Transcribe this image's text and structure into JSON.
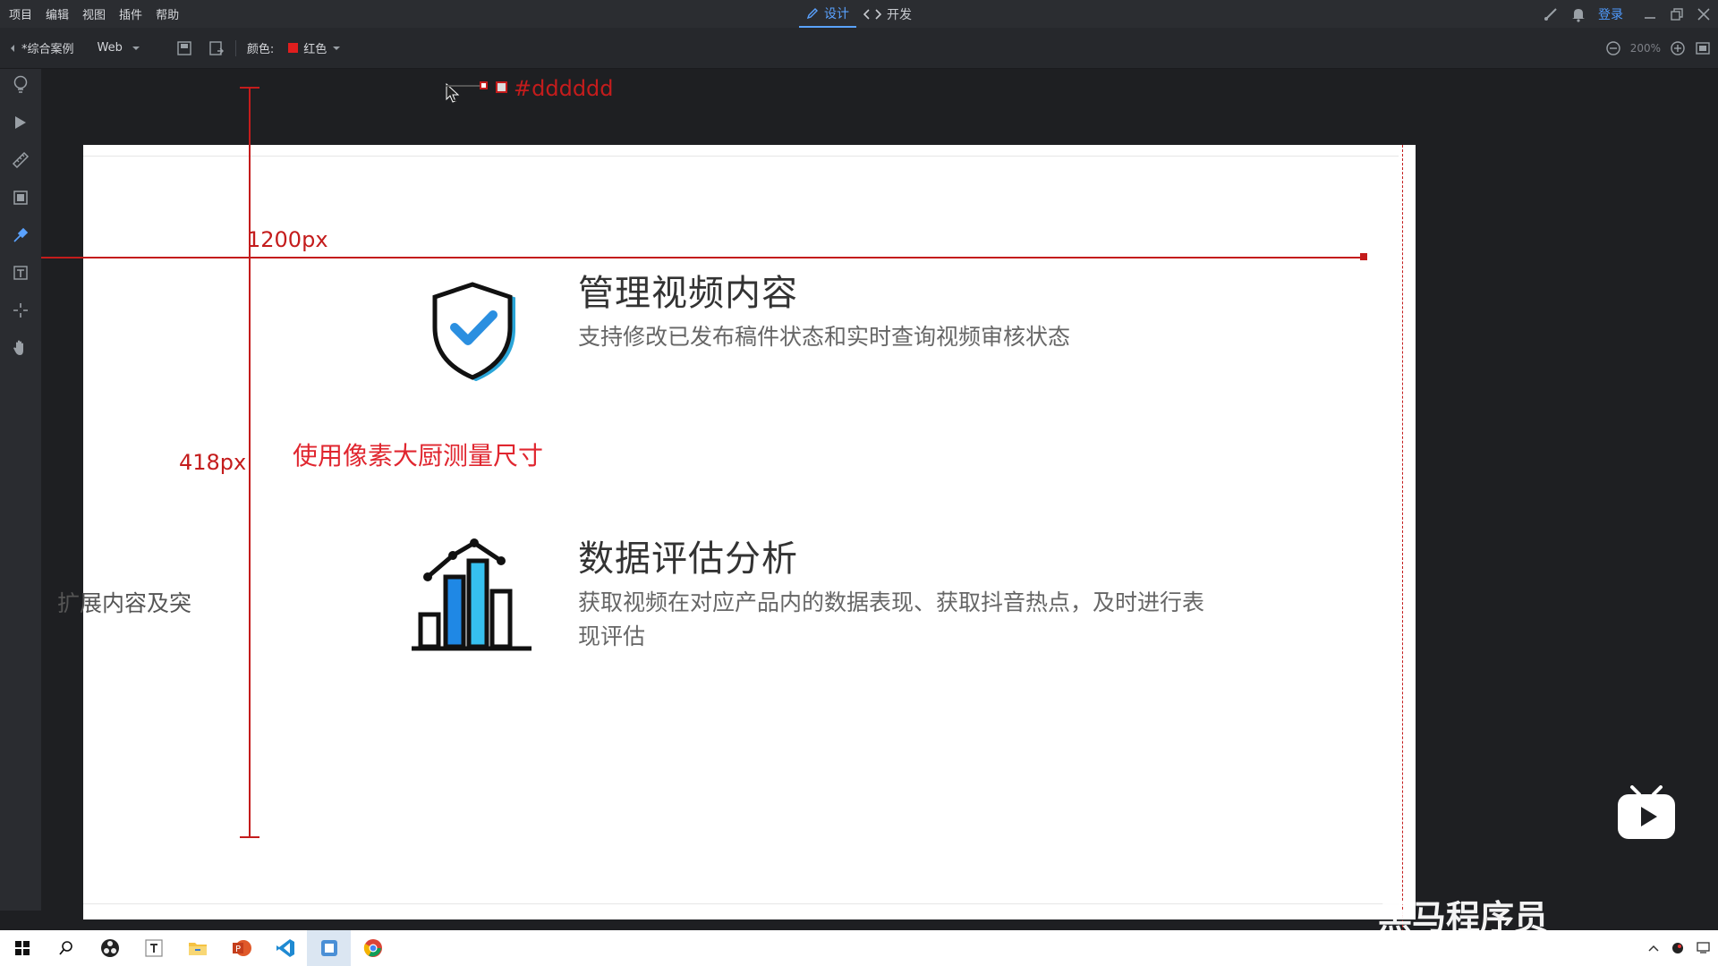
{
  "menubar": {
    "items": [
      "项目",
      "编辑",
      "视图",
      "插件",
      "帮助"
    ],
    "mode_tabs": [
      {
        "label": "设计",
        "icon": "pencil-icon",
        "active": true
      },
      {
        "label": "开发",
        "icon": "code-icon",
        "active": false
      }
    ],
    "login_label": "登录"
  },
  "toolbar": {
    "project_name": "*综合案例",
    "platform": "Web",
    "color_label": "颜色:",
    "color_value": "红色",
    "color_hex": "#e01e1e",
    "zoom_level": "200%"
  },
  "design": {
    "color_readout": "#dddddd",
    "width_measure": "1200px",
    "height_measure": "418px",
    "annotation": "使用像素大厨测量尺寸",
    "side_text": "扩展内容及突",
    "features": [
      {
        "title": "管理视频内容",
        "description": "支持修改已发布稿件状态和实时查询视频审核状态",
        "icon": "shield-check-icon"
      },
      {
        "title": "数据评估分析",
        "description_line1": "获取视频在对应产品内的数据表现、获取抖音热点，及时进行表",
        "description_line2": "现评估",
        "icon": "bar-chart-icon"
      }
    ]
  },
  "overlay": {
    "watermark": "黑马程序员"
  },
  "colors": {
    "accent_blue": "#5aa2ff",
    "measure_red": "#c41c1c",
    "annotation_red": "#e0262f"
  }
}
